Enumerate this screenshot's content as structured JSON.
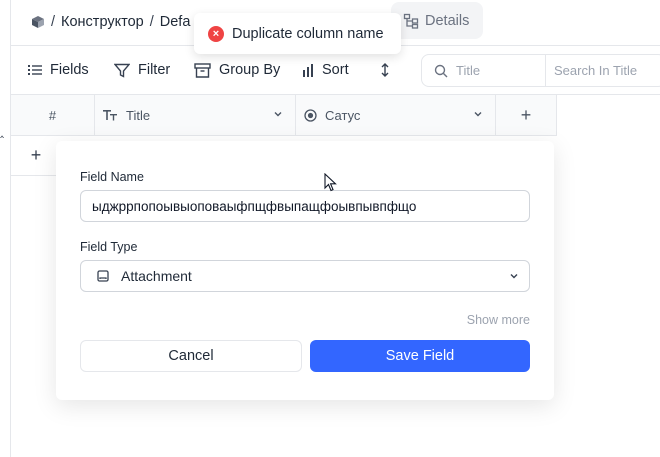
{
  "breadcrumb": {
    "separator": "/",
    "project": "Конструктор",
    "table": "Defa"
  },
  "details_tab": {
    "label": "Details"
  },
  "toast": {
    "message": "Duplicate column name",
    "icon": "error-icon"
  },
  "toolbar": {
    "fields": "Fields",
    "filter": "Filter",
    "group_by": "Group By",
    "sort": "Sort",
    "search_field": "Title",
    "search_placeholder": "Search In Title"
  },
  "grid": {
    "row_number_header": "#",
    "columns": [
      {
        "label": "Title",
        "icon": "text-type-icon"
      },
      {
        "label": "Сатус",
        "icon": "single-select-icon"
      }
    ],
    "add_column": "+",
    "add_row": "+"
  },
  "field_form": {
    "field_name_label": "Field Name",
    "field_name_value": "ыджррпопоывыоповаыфпщфвыпащфоывпывпфщо",
    "field_type_label": "Field Type",
    "field_type_value": "Attachment",
    "show_more": "Show more",
    "cancel": "Cancel",
    "save": "Save Field"
  },
  "colors": {
    "accent": "#3366ff",
    "error": "#ef4444",
    "border": "#e5e7eb"
  }
}
